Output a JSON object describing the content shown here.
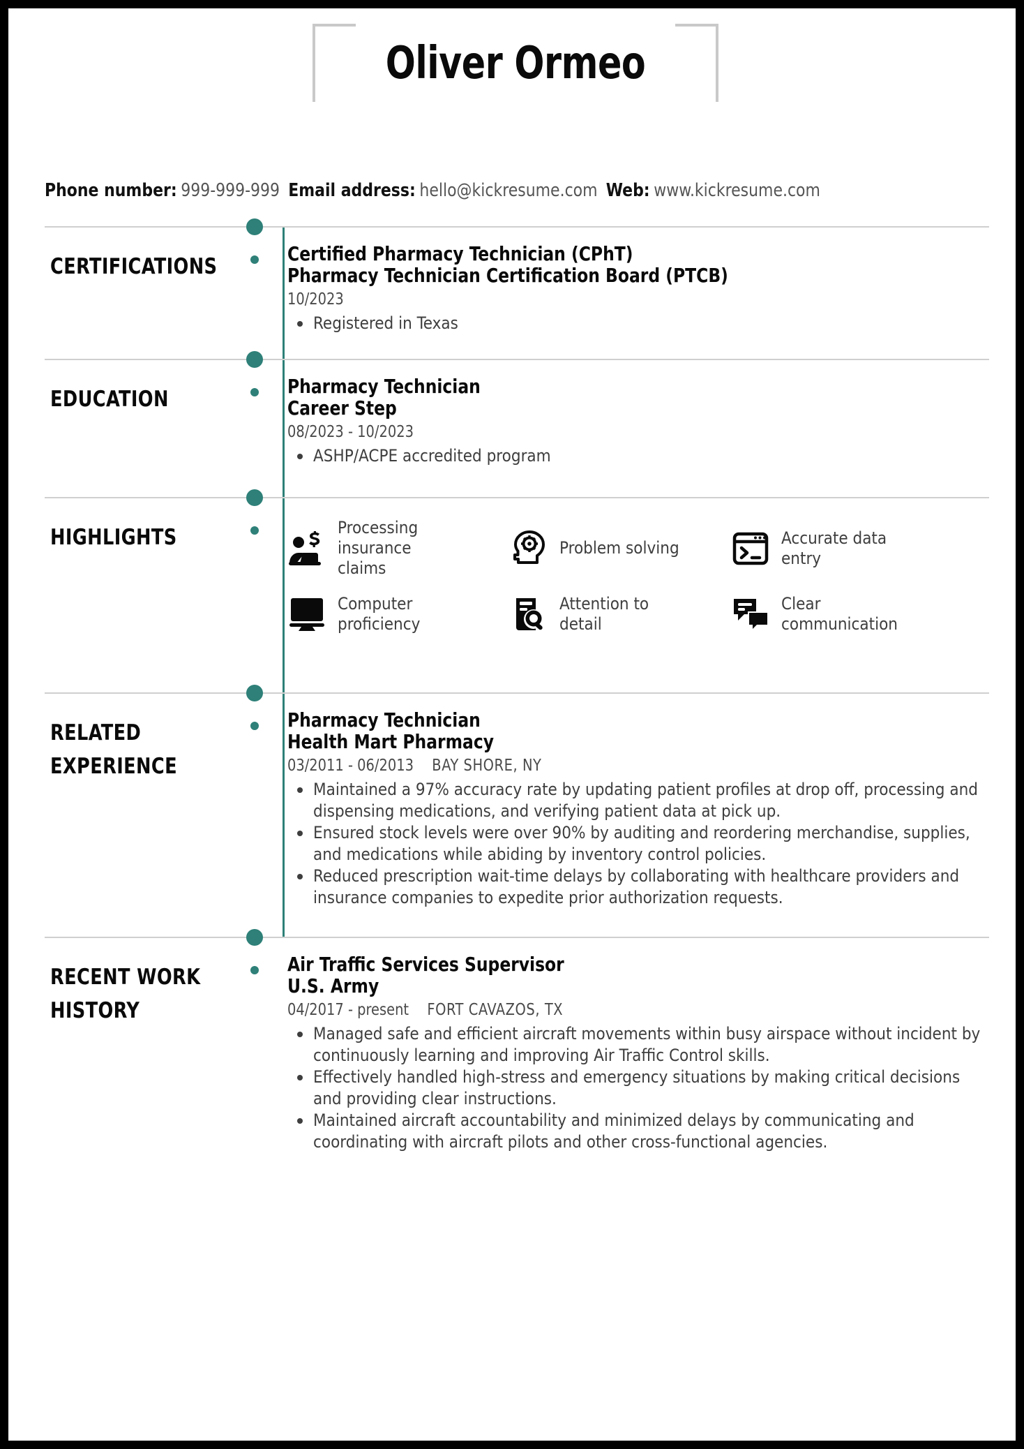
{
  "theme": {
    "accent": "#2E8078",
    "divider": "#cfcfcf",
    "bracket": "#c9c9c9",
    "text_dark": "#0a0a0a",
    "text_body": "#3e3e3e",
    "frame": "#000000"
  },
  "header": {
    "name": "Oliver Ormeo"
  },
  "contact": {
    "phone_label": "Phone number:",
    "phone_value": "999-999-999",
    "email_label": "Email address:",
    "email_value": "hello@kickresume.com",
    "web_label": "Web:",
    "web_value": "www.kickresume.com"
  },
  "sections": [
    {
      "id": "certifications",
      "title": "CERTIFICATIONS",
      "entry": {
        "title": "Certified Pharmacy Technician (CPhT)",
        "subtitle": "Pharmacy Technician Certification Board (PTCB)",
        "dates": "10/2023",
        "location": "",
        "bullets": [
          "Registered in Texas"
        ]
      }
    },
    {
      "id": "education",
      "title": "EDUCATION",
      "entry": {
        "title": "Pharmacy Technician",
        "subtitle": "Career Step",
        "dates": "08/2023 - 10/2023",
        "location": "",
        "bullets": [
          "ASHP/ACPE accredited program"
        ]
      }
    },
    {
      "id": "highlights",
      "title": "HIGHLIGHTS",
      "highlights": [
        {
          "icon": "insurance-claims-icon",
          "label": "Processing insurance claims"
        },
        {
          "icon": "problem-solving-icon",
          "label": "Problem solving"
        },
        {
          "icon": "data-entry-icon",
          "label": "Accurate data entry"
        },
        {
          "icon": "computer-icon",
          "label": "Computer proficiency"
        },
        {
          "icon": "attention-detail-icon",
          "label": "Attention to detail"
        },
        {
          "icon": "communication-icon",
          "label": "Clear communication"
        }
      ]
    },
    {
      "id": "related-experience",
      "title": "RELATED EXPERIENCE",
      "entry": {
        "title": "Pharmacy Technician",
        "subtitle": "Health Mart Pharmacy",
        "dates": "03/2011 - 06/2013",
        "location": "BAY SHORE, NY",
        "bullets": [
          "Maintained a 97% accuracy rate by updating patient profiles at drop off, processing and dispensing medications, and verifying patient data at pick up.",
          "Ensured stock levels were over 90% by auditing and reordering merchandise, supplies, and medications while abiding by inventory control policies.",
          "Reduced prescription wait-time delays by collaborating with healthcare providers and insurance companies to expedite prior authorization requests."
        ]
      }
    },
    {
      "id": "recent-work-history",
      "title": "RECENT WORK HISTORY",
      "entry": {
        "title": "Air Traffic Services Supervisor",
        "subtitle": "U.S. Army",
        "dates": "04/2017 - present",
        "location": "FORT CAVAZOS, TX",
        "bullets": [
          "Managed safe and efficient aircraft movements within busy airspace without incident by continuously learning and improving Air Traffic Control skills.",
          "Effectively handled high-stress and emergency situations by making critical decisions and providing clear instructions.",
          "Maintained aircraft accountability and minimized delays by communicating and coordinating with aircraft pilots and other cross-functional agencies."
        ]
      }
    }
  ]
}
